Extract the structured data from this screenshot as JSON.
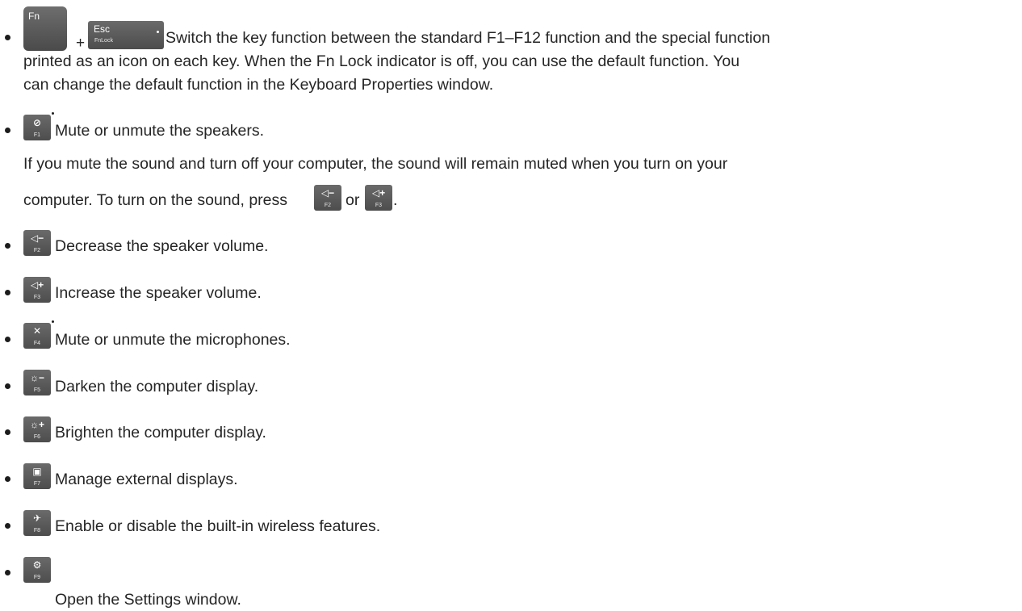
{
  "items": [
    {
      "keys": {
        "fn": "Fn",
        "plus": "+",
        "esc": "Esc",
        "esc_sub": "FnLock"
      },
      "lines": [
        "Switch the key function between the standard F1–F12 function and the special function",
        "printed as an icon on each key. When the Fn Lock indicator is off, you can use the default function. You",
        "can change the default function in the Keyboard Properties window."
      ]
    },
    {
      "key": {
        "glyph": "⊘",
        "fnum": "F1",
        "icon": "speaker-mute-icon"
      },
      "text": "Mute or unmute the speakers.",
      "note_line1": "If you mute the sound and turn off your computer, the sound will remain muted when you turn on your",
      "note_line2_pre": "computer. To turn on the sound, press",
      "note_or": "or",
      "note_end": ".",
      "note_key_a": {
        "glyph": "◁−",
        "fnum": "F2"
      },
      "note_key_b": {
        "glyph": "◁+",
        "fnum": "F3"
      }
    },
    {
      "key": {
        "glyph": "◁−",
        "fnum": "F2",
        "icon": "volume-down-icon"
      },
      "text": "Decrease the speaker volume."
    },
    {
      "key": {
        "glyph": "◁+",
        "fnum": "F3",
        "icon": "volume-up-icon"
      },
      "text": "Increase the speaker volume."
    },
    {
      "key": {
        "glyph": "✕",
        "fnum": "F4",
        "icon": "microphone-mute-icon"
      },
      "text": "Mute or unmute the microphones."
    },
    {
      "key": {
        "glyph": "☼−",
        "fnum": "F5",
        "icon": "brightness-down-icon"
      },
      "text": "Darken the computer display."
    },
    {
      "key": {
        "glyph": "☼+",
        "fnum": "F6",
        "icon": "brightness-up-icon"
      },
      "text": "Brighten the computer display."
    },
    {
      "key": {
        "glyph": "▣",
        "fnum": "F7",
        "icon": "external-display-icon"
      },
      "text": "Manage external displays."
    },
    {
      "key": {
        "glyph": "✈",
        "fnum": "F8",
        "icon": "wireless-off-icon"
      },
      "text": "Enable or disable the built-in wireless features."
    },
    {
      "key": {
        "glyph": "⚙",
        "fnum": "F9",
        "icon": "settings-gear-icon"
      },
      "text": "Open the Settings window."
    }
  ]
}
